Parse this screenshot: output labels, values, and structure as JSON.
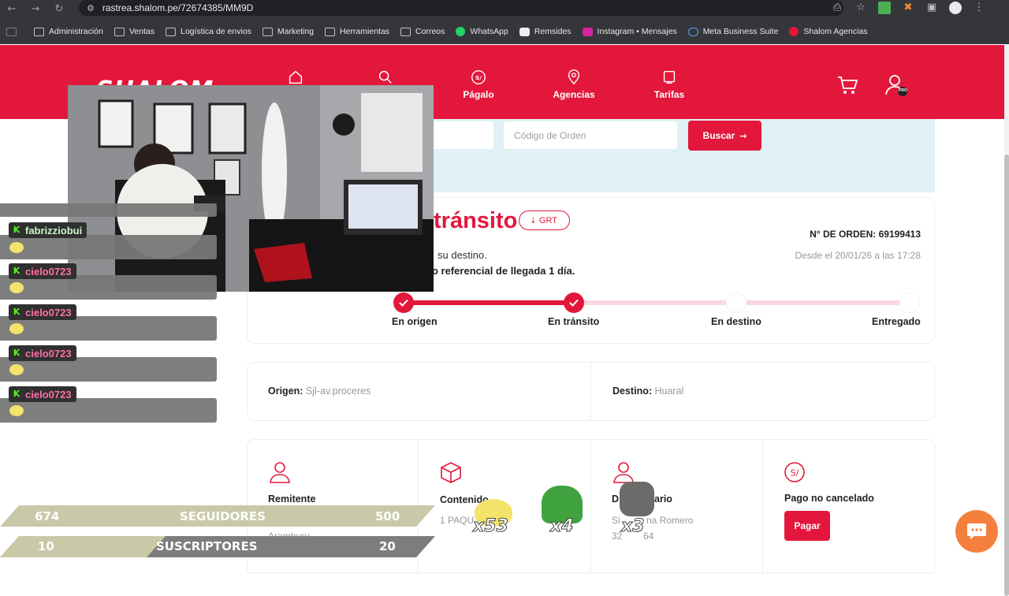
{
  "browser": {
    "url": "rastrea.shalom.pe/72674385/MM9D",
    "nav_icons": [
      "back-icon",
      "forward-icon",
      "reload-icon",
      "site-info-icon"
    ],
    "bookmarks": [
      {
        "label": "Administración",
        "icon": "folder-icon"
      },
      {
        "label": "Ventas",
        "icon": "folder-icon"
      },
      {
        "label": "Logística de envios",
        "icon": "folder-icon"
      },
      {
        "label": "Marketing",
        "icon": "folder-icon"
      },
      {
        "label": "Herramientas",
        "icon": "folder-icon"
      },
      {
        "label": "Correos",
        "icon": "folder-icon"
      },
      {
        "label": "WhatsApp",
        "icon": "whatsapp-icon"
      },
      {
        "label": "Remsides",
        "icon": "remsides-icon"
      },
      {
        "label": "Instagram • Mensajes",
        "icon": "instagram-icon"
      },
      {
        "label": "Meta Business Suite",
        "icon": "meta-icon"
      },
      {
        "label": "Shalom Agencias",
        "icon": "shalom-icon"
      }
    ]
  },
  "header": {
    "logo": "SHALOM",
    "nav": [
      {
        "label": "",
        "icon": "home-icon"
      },
      {
        "label": "",
        "icon": "search-icon"
      },
      {
        "label": "Págalo",
        "icon": "soles-icon"
      },
      {
        "label": "Agencias",
        "icon": "location-pin-icon"
      },
      {
        "label": "Tarifas",
        "icon": "price-tag-icon"
      }
    ],
    "pro_badge": "PRO",
    "accent": "#e3173b"
  },
  "search": {
    "order_placeholder": "Código de Orden",
    "button_label": "Buscar"
  },
  "status": {
    "title": "tránsito",
    "grt_label": "GRT",
    "line1": "su destino.",
    "line2": "o referencial de llegada 1 día.",
    "order_number": "N° DE ORDEN: 69199413",
    "since": "Desde el 20/01/26 a las 17:28",
    "steps": [
      {
        "label": "En origen",
        "done": true
      },
      {
        "label": "En tránsito",
        "done": true
      },
      {
        "label": "En destino",
        "done": false
      },
      {
        "label": "Entregado",
        "done": false
      }
    ]
  },
  "route": {
    "origin_label": "Origen:",
    "origin_value": "Sjl-av.proceres",
    "destination_label": "Destino:",
    "destination_value": "Huaral"
  },
  "info": {
    "sender_title": "Remitente",
    "sender_value": "Aramburu",
    "content_title": "Contenido",
    "content_value": "1 PAQU",
    "recipient_title": "D",
    "recipient_title_end": "ario",
    "recipient_name_start": "Si",
    "recipient_name_end": "na Romero",
    "recipient_phone_start": "32",
    "recipient_phone_end": "64",
    "payment_title": "Pago no cancelado",
    "pay_button": "Pagar"
  },
  "stream_overlay": {
    "chat": [
      {
        "user": "fabrizziobui",
        "color": "#c8f7c5"
      },
      {
        "user": "cielo0723",
        "color": "#ff6fa8"
      },
      {
        "user": "cielo0723",
        "color": "#ff6fa8"
      },
      {
        "user": "cielo0723",
        "color": "#ff6fa8"
      },
      {
        "user": "cielo0723",
        "color": "#ff6fa8"
      }
    ],
    "goals": [
      {
        "current": "674",
        "label": "SEGUIDORES",
        "target": "500"
      },
      {
        "current": "10",
        "label": "SUSCRIPTORES",
        "target": "20"
      }
    ],
    "emote_counts": [
      "x53",
      "x4",
      "x3"
    ]
  }
}
